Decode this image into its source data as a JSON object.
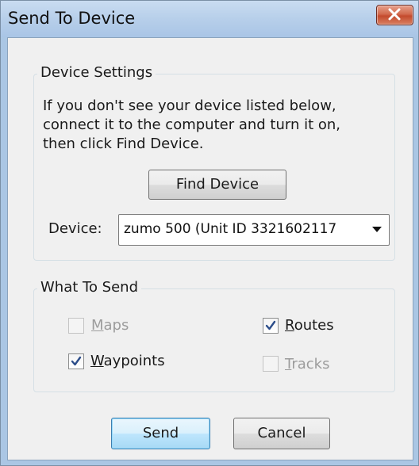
{
  "window": {
    "title": "Send To Device"
  },
  "device_settings": {
    "legend": "Device Settings",
    "description_lines": [
      "If you don't see your device listed below,",
      "connect it to the computer and turn it on,",
      "then click Find Device."
    ],
    "find_device_label": "Find Device",
    "device_label": "Device:",
    "device_value": "zumo 500 (Unit ID 3321602117"
  },
  "what_to_send": {
    "legend": "What To Send",
    "options": [
      {
        "label": "Maps",
        "checked": false,
        "enabled": false
      },
      {
        "label": "Routes",
        "checked": true,
        "enabled": true
      },
      {
        "label": "Waypoints",
        "checked": true,
        "enabled": true
      },
      {
        "label": "Tracks",
        "checked": false,
        "enabled": false
      }
    ]
  },
  "buttons": {
    "send_label": "Send",
    "cancel_label": "Cancel"
  },
  "colors": {
    "title_bar": "#b7cfea",
    "close_button": "#c44a2d",
    "dialog_bg": "#f0f0f0",
    "default_button": "#bee6fd"
  },
  "icons": {
    "close": "close-x-icon",
    "dropdown": "chevron-down-icon",
    "check": "checkmark-icon"
  }
}
